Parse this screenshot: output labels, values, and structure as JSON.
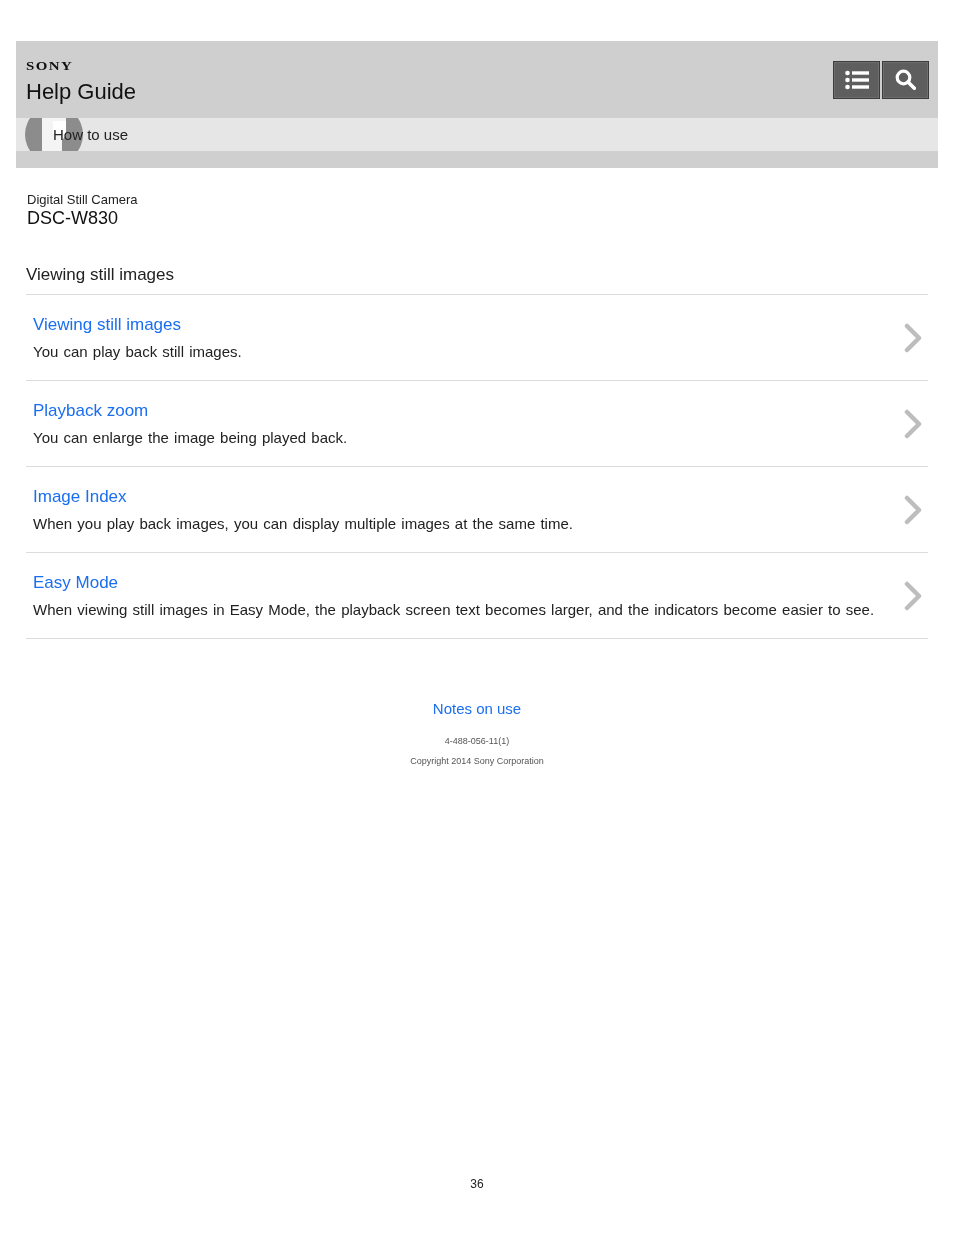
{
  "header": {
    "brand": "SONY",
    "title": "Help Guide",
    "breadcrumb": "How to use",
    "buttons": [
      {
        "kind": "menu"
      },
      {
        "kind": "search"
      }
    ]
  },
  "product": {
    "category": "Digital Still Camera",
    "model": "DSC-W830"
  },
  "section": {
    "title": "Viewing still images",
    "items": [
      {
        "title": "Viewing still images",
        "description": "You can play back still images."
      },
      {
        "title": "Playback zoom",
        "description": "You can enlarge the image being played back."
      },
      {
        "title": "Image Index",
        "description": "When you play back images, you can display multiple images at the same time."
      },
      {
        "title": "Easy Mode",
        "description": "When viewing still images in Easy Mode, the playback screen text becomes larger, and the indicators become easier to see."
      }
    ]
  },
  "footer": {
    "link": "Notes on use",
    "code": "4-488-056-11(1)",
    "copyright": "Copyright 2014 Sony Corporation"
  },
  "page_number": "36"
}
